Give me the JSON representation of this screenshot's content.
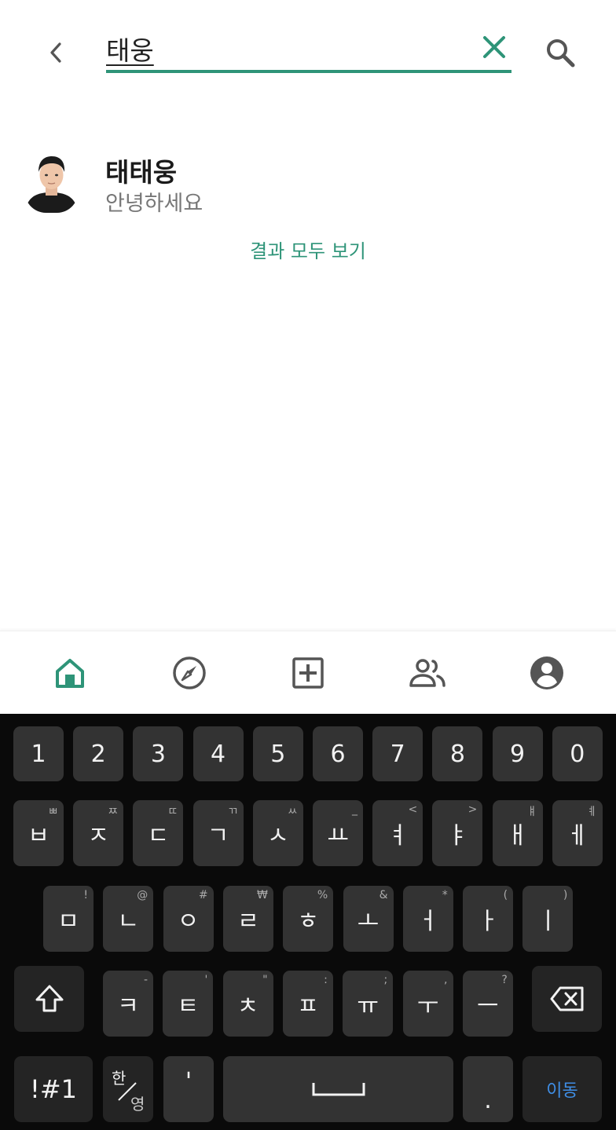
{
  "search": {
    "query": "태웅"
  },
  "results": [
    {
      "name": "태태웅",
      "status": "안녕하세요"
    }
  ],
  "see_all_label": "결과 모두 보기",
  "nav_items": [
    "home-icon",
    "compass-icon",
    "add-box-icon",
    "people-icon",
    "account-icon"
  ],
  "colors": {
    "accent": "#2e9478",
    "keyboard_bg": "#0a0a0a",
    "key_bg": "#333333",
    "go_key_text": "#3f8ee6"
  },
  "keyboard": {
    "numbers": [
      "1",
      "2",
      "3",
      "4",
      "5",
      "6",
      "7",
      "8",
      "9",
      "0"
    ],
    "row1": [
      {
        "k": "ㅂ",
        "s": "ㅃ"
      },
      {
        "k": "ㅈ",
        "s": "ㅉ"
      },
      {
        "k": "ㄷ",
        "s": "ㄸ"
      },
      {
        "k": "ㄱ",
        "s": "ㄲ"
      },
      {
        "k": "ㅅ",
        "s": "ㅆ"
      },
      {
        "k": "ㅛ",
        "s": "_"
      },
      {
        "k": "ㅕ",
        "s": "<"
      },
      {
        "k": "ㅑ",
        "s": ">"
      },
      {
        "k": "ㅐ",
        "s": "ㅒ"
      },
      {
        "k": "ㅔ",
        "s": "ㅖ"
      }
    ],
    "row2": [
      {
        "k": "ㅁ",
        "s": "!"
      },
      {
        "k": "ㄴ",
        "s": "@"
      },
      {
        "k": "ㅇ",
        "s": "#"
      },
      {
        "k": "ㄹ",
        "s": "₩"
      },
      {
        "k": "ㅎ",
        "s": "%"
      },
      {
        "k": "ㅗ",
        "s": "&"
      },
      {
        "k": "ㅓ",
        "s": "*"
      },
      {
        "k": "ㅏ",
        "s": "("
      },
      {
        "k": "ㅣ",
        "s": ")"
      }
    ],
    "row3": [
      {
        "k": "ㅋ",
        "s": "-"
      },
      {
        "k": "ㅌ",
        "s": "'"
      },
      {
        "k": "ㅊ",
        "s": "\""
      },
      {
        "k": "ㅍ",
        "s": ":"
      },
      {
        "k": "ㅠ",
        "s": ";"
      },
      {
        "k": "ㅜ",
        "s": ","
      },
      {
        "k": "ㅡ",
        "s": "?"
      }
    ],
    "symbols_label": "!#1",
    "lang_top": "한",
    "lang_bottom": "영",
    "apostrophe": "'",
    "period": ".",
    "go_label": "이동"
  }
}
